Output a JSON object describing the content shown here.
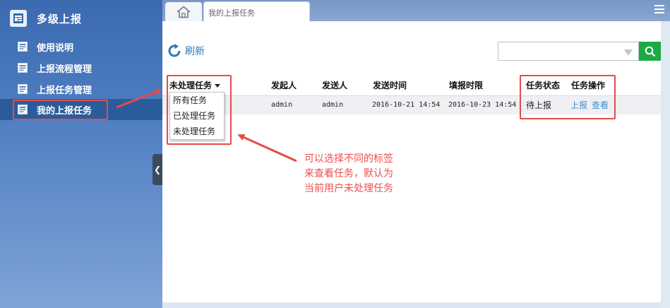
{
  "sidebar": {
    "title": "多级上报",
    "items": [
      {
        "label": "使用说明"
      },
      {
        "label": "上报流程管理"
      },
      {
        "label": "上报任务管理"
      },
      {
        "label": "我的上报任务"
      }
    ]
  },
  "tabs": {
    "active_label": "我的上报任务"
  },
  "toolbar": {
    "refresh_label": "刷新",
    "search_value": ""
  },
  "table": {
    "filter_label": "未处理任务",
    "columns": [
      "发起人",
      "发送人",
      "发送时间",
      "填报时限",
      "任务状态",
      "任务操作"
    ],
    "rows": [
      {
        "initiator": "admin",
        "sender": "admin",
        "send_time": "2016-10-21 14:54",
        "deadline": "2016-10-23 14:54",
        "status": "待上报",
        "action_report": "上报",
        "action_view": "查看"
      }
    ]
  },
  "filter_dropdown": {
    "options": [
      "所有任务",
      "已处理任务",
      "未处理任务"
    ]
  },
  "annotation": {
    "text": "可以选择不同的标签\n来查看任务，默认为\n当前用户未处理任务"
  },
  "colors": {
    "accent": "#2e7ab7",
    "search_button": "#1da946",
    "highlight": "#e64b4b",
    "link": "#3e8ed4"
  }
}
